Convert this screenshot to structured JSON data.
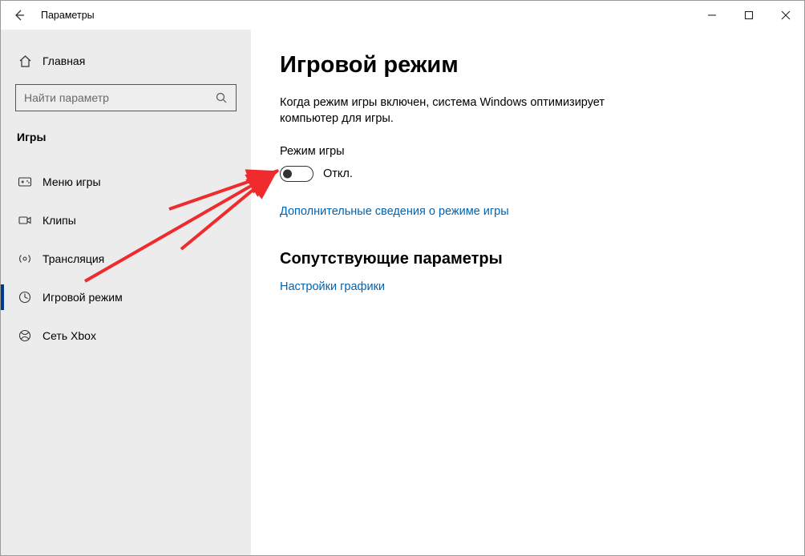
{
  "window": {
    "title": "Параметры"
  },
  "sidebar": {
    "home_label": "Главная",
    "search_placeholder": "Найти параметр",
    "section_label": "Игры",
    "items": [
      {
        "label": "Меню игры",
        "icon": "game-bar-icon",
        "selected": false
      },
      {
        "label": "Клипы",
        "icon": "captures-icon",
        "selected": false
      },
      {
        "label": "Трансляция",
        "icon": "broadcast-icon",
        "selected": false
      },
      {
        "label": "Игровой режим",
        "icon": "game-mode-icon",
        "selected": true
      },
      {
        "label": "Сеть Xbox",
        "icon": "xbox-net-icon",
        "selected": false
      }
    ]
  },
  "content": {
    "title": "Игровой режим",
    "description": "Когда режим игры включен, система Windows оптимизирует компьютер для игры.",
    "toggle_caption": "Режим игры",
    "toggle_state_label": "Откл.",
    "learn_more_link": "Дополнительные сведения о режиме игры",
    "related_title": "Сопутствующие параметры",
    "related_link": "Настройки графики"
  }
}
